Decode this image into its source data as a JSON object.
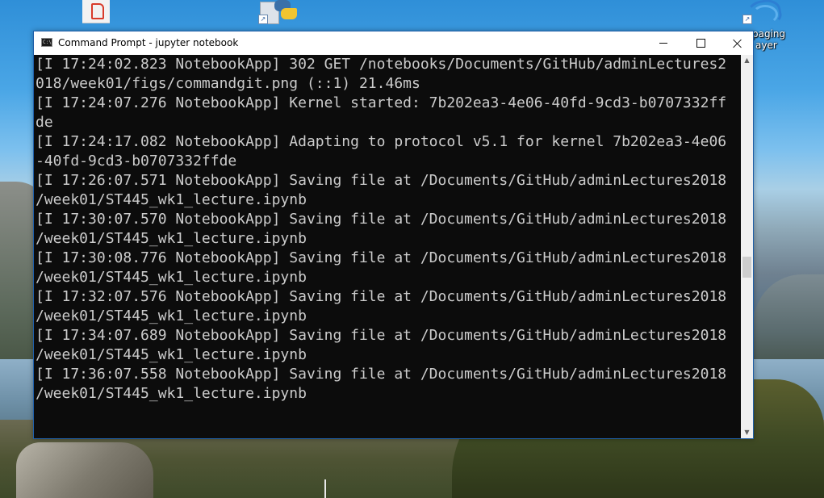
{
  "desktop": {
    "icons": [
      {
        "name": "pdf-shortcut",
        "label": ""
      },
      {
        "name": "python-shortcut",
        "label": ""
      },
      {
        "name": "paging-player-shortcut",
        "label": "...paging\n...ayer"
      }
    ],
    "paging_label_line1": "paging",
    "paging_label_line2": "ayer"
  },
  "window": {
    "title": "Command Prompt - jupyter  notebook",
    "app_icon_text": "C:\\",
    "controls": {
      "minimize": "minimize",
      "maximize": "maximize",
      "close": "close"
    }
  },
  "console": {
    "lines": [
      "[I 17:24:02.823 NotebookApp] 302 GET /notebooks/Documents/GitHub/adminLectures2",
      "018/week01/figs/commandgit.png (::1) 21.46ms",
      "[I 17:24:07.276 NotebookApp] Kernel started: 7b202ea3-4e06-40fd-9cd3-b0707332ff",
      "de",
      "[I 17:24:17.082 NotebookApp] Adapting to protocol v5.1 for kernel 7b202ea3-4e06",
      "-40fd-9cd3-b0707332ffde",
      "[I 17:26:07.571 NotebookApp] Saving file at /Documents/GitHub/adminLectures2018",
      "/week01/ST445_wk1_lecture.ipynb",
      "[I 17:30:07.570 NotebookApp] Saving file at /Documents/GitHub/adminLectures2018",
      "/week01/ST445_wk1_lecture.ipynb",
      "[I 17:30:08.776 NotebookApp] Saving file at /Documents/GitHub/adminLectures2018",
      "/week01/ST445_wk1_lecture.ipynb",
      "[I 17:32:07.576 NotebookApp] Saving file at /Documents/GitHub/adminLectures2018",
      "/week01/ST445_wk1_lecture.ipynb",
      "[I 17:34:07.689 NotebookApp] Saving file at /Documents/GitHub/adminLectures2018",
      "/week01/ST445_wk1_lecture.ipynb",
      "[I 17:36:07.558 NotebookApp] Saving file at /Documents/GitHub/adminLectures2018",
      "/week01/ST445_wk1_lecture.ipynb"
    ],
    "background": "#0c0c0c",
    "foreground": "#cccccc"
  },
  "scrollbar": {
    "up_arrow": "▲",
    "down_arrow": "▼"
  }
}
